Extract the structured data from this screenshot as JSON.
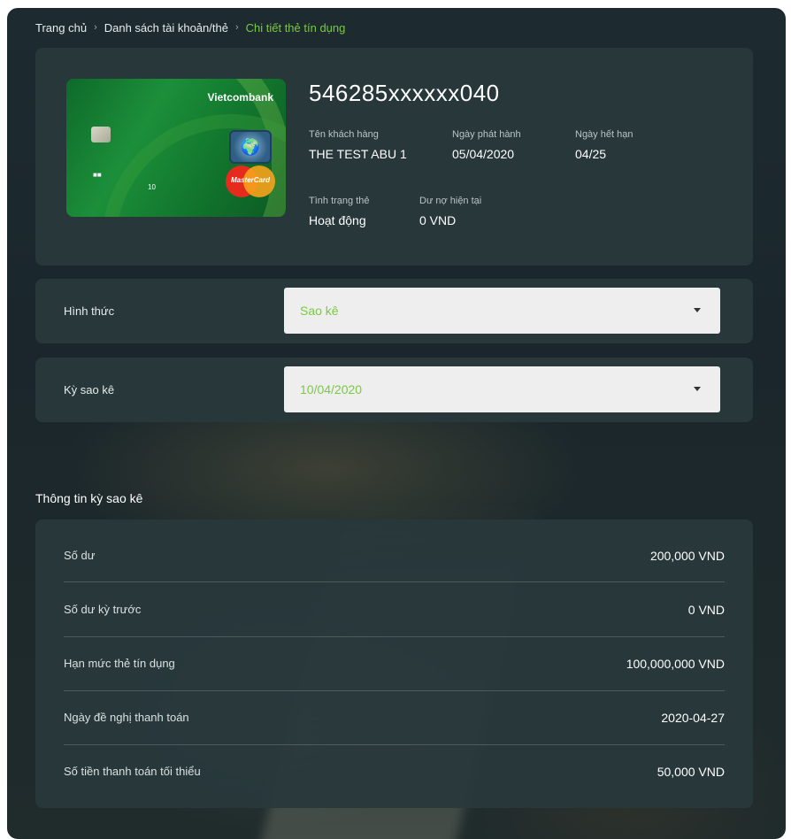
{
  "breadcrumb": {
    "home": "Trang chủ",
    "accounts": "Danh sách tài khoản/thẻ",
    "current": "Chi tiết thẻ tín dụng",
    "separator": "›"
  },
  "card": {
    "bank_logo_text": "Vietcombank",
    "network_text": "MasterCard",
    "card_mini_1": "■■",
    "card_mini_2": "10",
    "number": "546285xxxxxx040",
    "customer_label": "Tên khách hàng",
    "customer_value": "THE TEST ABU 1",
    "issue_label": "Ngày phát hành",
    "issue_value": "05/04/2020",
    "expiry_label": "Ngày hết hạn",
    "expiry_value": "04/25",
    "status_label": "Tình trạng thẻ",
    "status_value": "Hoạt động",
    "debt_label": "Dư nợ hiện tại",
    "debt_value": "0 VND"
  },
  "form": {
    "type_label": "Hình thức",
    "type_value": "Sao kê",
    "period_label": "Kỳ sao kê",
    "period_value": "10/04/2020"
  },
  "statement": {
    "title": "Thông tin kỳ sao kê",
    "rows": [
      {
        "label": "Số dư",
        "value": "200,000 VND"
      },
      {
        "label": "Số dư kỳ trước",
        "value": "0 VND"
      },
      {
        "label": "Hạn mức thẻ tín dụng",
        "value": "100,000,000 VND"
      },
      {
        "label": "Ngày đề nghị thanh toán",
        "value": "2020-04-27"
      },
      {
        "label": "Số tiền thanh toán tối thiểu",
        "value": "50,000 VND"
      }
    ]
  },
  "colors": {
    "accent": "#7ac943",
    "panel": "#28383c",
    "background": "#1c282b"
  }
}
